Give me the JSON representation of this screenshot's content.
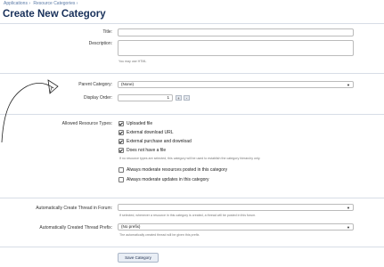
{
  "breadcrumb": [
    "Applications ›",
    "Resource Categories ›"
  ],
  "page_title": "Create New Category",
  "form": {
    "title_label": "Title:",
    "title_value": "",
    "description_label": "Description:",
    "description_value": "",
    "description_hint": "You may use HTML",
    "parent_label": "Parent Category:",
    "parent_value": "(None)",
    "display_order_label": "Display Order:",
    "display_order_value": "1",
    "plus": "+",
    "minus": "-",
    "allowed_types_label": "Allowed Resource Types:",
    "types": [
      {
        "label": "Uploaded file",
        "checked": true
      },
      {
        "label": "External download URL",
        "checked": true
      },
      {
        "label": "External purchase and download",
        "checked": true
      },
      {
        "label": "Does not have a file",
        "checked": true
      }
    ],
    "types_hint": "If no resource types are selected, this category will be used to establish the category hierarchy only.",
    "moderate_resources": "Always moderate resources posted in this category",
    "moderate_updates": "Always moderate updates in this category",
    "thread_forum_label": "Automatically Create Thread in Forum:",
    "thread_forum_value": "",
    "thread_forum_hint": "If selected, whenever a resource in this category is created, a thread will be posted in this forum.",
    "thread_prefix_label": "Automatically Created Thread Prefix:",
    "thread_prefix_value": "(No prefix)",
    "thread_prefix_hint": "The automatically created thread will be given this prefix.",
    "save": "Save Category"
  }
}
